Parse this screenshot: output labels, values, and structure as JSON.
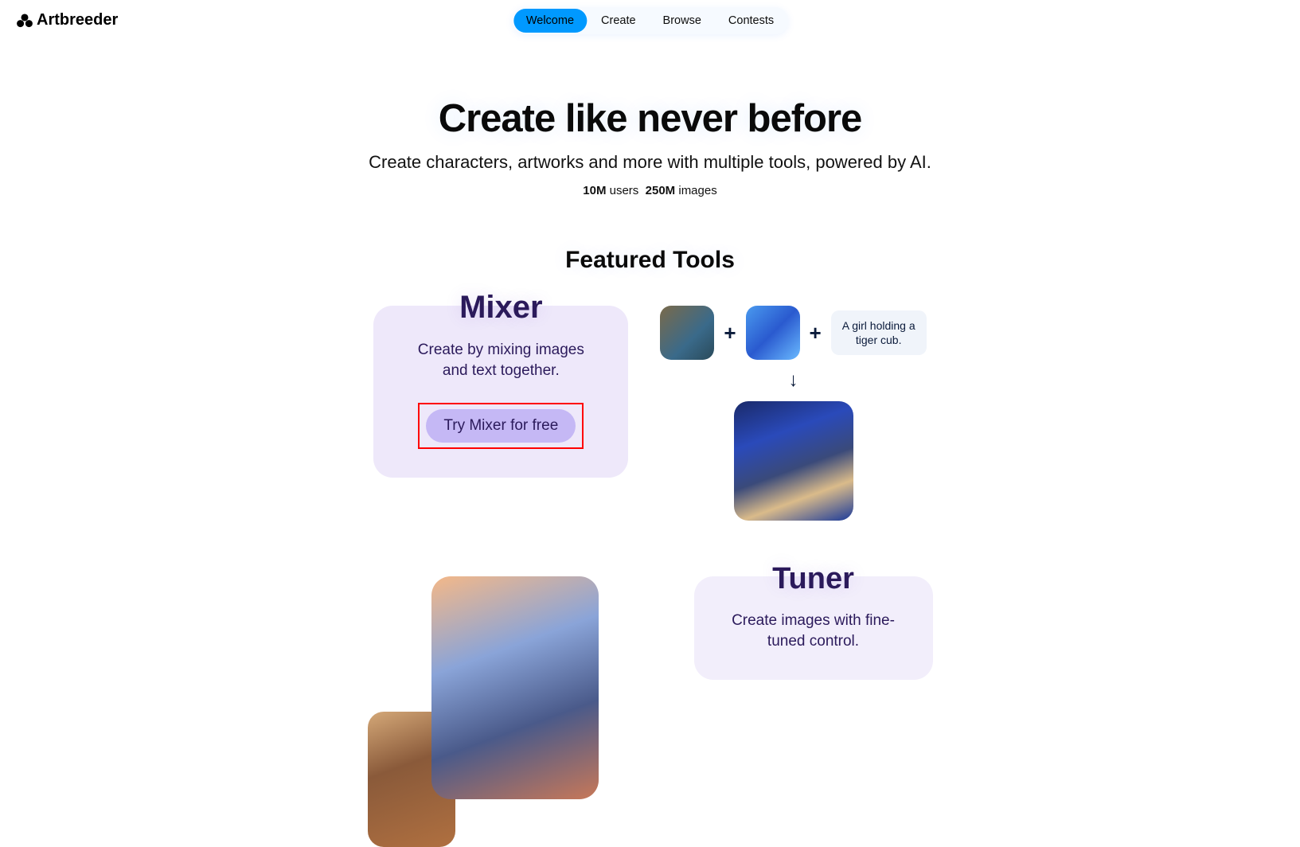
{
  "header": {
    "logo_text": "Artbreeder",
    "nav": [
      "Welcome",
      "Create",
      "Browse",
      "Contests"
    ],
    "nav_active_index": 0
  },
  "hero": {
    "title": "Create like never before",
    "subtitle": "Create characters, artworks and more with multiple tools, powered by AI.",
    "stat1_value": "10M",
    "stat1_label": " users",
    "stat2_value": "250M",
    "stat2_label": " images"
  },
  "featured": {
    "title": "Featured Tools"
  },
  "mixer": {
    "title": "Mixer",
    "description": "Create by mixing images and text together.",
    "cta": "Try Mixer for free",
    "prompt_text": "A girl holding a tiger cub.",
    "plus": "+",
    "arrow": "↓"
  },
  "tuner": {
    "title": "Tuner",
    "description": "Create images with fine-tuned control."
  }
}
